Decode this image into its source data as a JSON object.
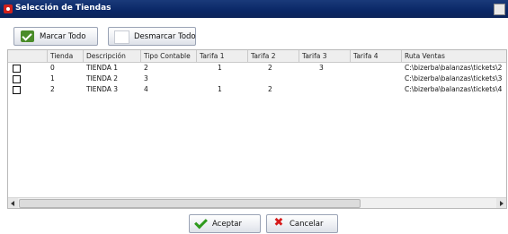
{
  "window": {
    "title": "Selección de Tiendas"
  },
  "toolbar": {
    "select_all_label": "Marcar Todo",
    "deselect_all_label": "Desmarcar Todo"
  },
  "table": {
    "columns": [
      "Tienda",
      "Descripción",
      "Tipo Contable",
      "Tarifa 1",
      "Tarifa 2",
      "Tarifa 3",
      "Tarifa 4",
      "Ruta Ventas"
    ],
    "rows": [
      {
        "tienda": "0",
        "descripcion": "TIENDA 1",
        "tipo": "2",
        "t1": "1",
        "t2": "2",
        "t3": "3",
        "t4": "",
        "ruta": "C:\\bizerba\\balanzas\\tickets\\2"
      },
      {
        "tienda": "1",
        "descripcion": "TIENDA 2",
        "tipo": "3",
        "t1": "",
        "t2": "",
        "t3": "",
        "t4": "",
        "ruta": "C:\\bizerba\\balanzas\\tickets\\3"
      },
      {
        "tienda": "2",
        "descripcion": "TIENDA 3",
        "tipo": "4",
        "t1": "1",
        "t2": "2",
        "t3": "",
        "t4": "",
        "ruta": "C:\\bizerba\\balanzas\\tickets\\4"
      }
    ]
  },
  "footer": {
    "accept_label": "Aceptar",
    "cancel_label": "Cancelar"
  },
  "icons": {
    "app": "app-icon",
    "select_all": "check-icon",
    "accept": "ok-icon",
    "cancel": "cancel-icon"
  }
}
